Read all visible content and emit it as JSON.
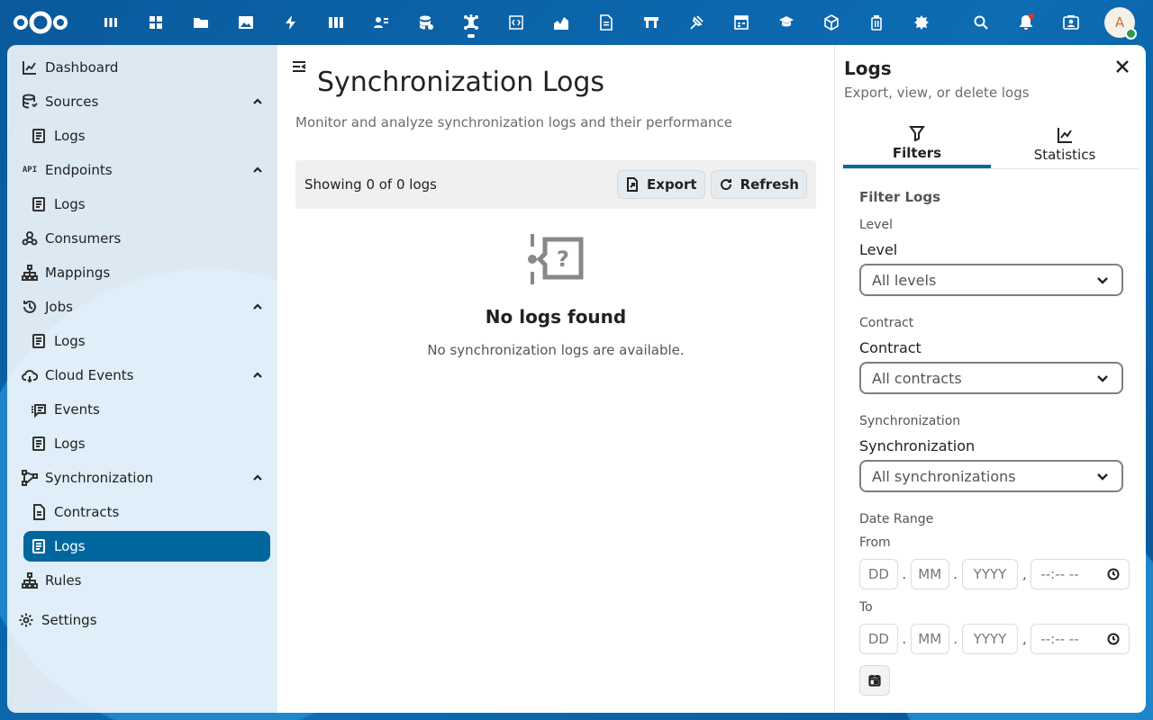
{
  "topbar": {
    "apps": [
      "dashboard-app",
      "tables-app",
      "files-app",
      "photos-app",
      "activity-app",
      "deck-app",
      "contacts-app",
      "database-app",
      "openconnector-app",
      "code-app",
      "analytics-app",
      "documents-app",
      "forms-app",
      "announcements-app",
      "calendar-table-app",
      "education-app",
      "packages-app",
      "archive-app",
      "admin-app"
    ],
    "active_app_index": 8,
    "avatar_letter": "A"
  },
  "sidebar": {
    "items": [
      {
        "label": "Dashboard"
      },
      {
        "label": "Sources"
      },
      {
        "label": "Logs"
      },
      {
        "label": "Endpoints"
      },
      {
        "label": "Logs"
      },
      {
        "label": "Consumers"
      },
      {
        "label": "Mappings"
      },
      {
        "label": "Jobs"
      },
      {
        "label": "Logs"
      },
      {
        "label": "Cloud Events"
      },
      {
        "label": "Events"
      },
      {
        "label": "Logs"
      },
      {
        "label": "Synchronization"
      },
      {
        "label": "Contracts"
      },
      {
        "label": "Logs"
      },
      {
        "label": "Rules"
      },
      {
        "label": "Settings"
      }
    ],
    "api_badge": "API"
  },
  "main": {
    "title": "Synchronization Logs",
    "subtitle": "Monitor and analyze synchronization logs and their performance",
    "count_text": "Showing 0 of 0 logs",
    "export_label": "Export",
    "refresh_label": "Refresh",
    "empty_title": "No logs found",
    "empty_desc": "No synchronization logs are available."
  },
  "panel": {
    "title": "Logs",
    "subtitle": "Export, view, or delete logs",
    "tabs": [
      {
        "label": "Filters"
      },
      {
        "label": "Statistics"
      }
    ],
    "filters_heading": "Filter Logs",
    "level": {
      "caption": "Level",
      "label": "Level",
      "value": "All levels"
    },
    "contract": {
      "caption": "Contract",
      "label": "Contract",
      "value": "All contracts"
    },
    "synchronization": {
      "caption": "Synchronization",
      "label": "Synchronization",
      "value": "All synchronizations"
    },
    "date_range": {
      "caption": "Date Range",
      "from_label": "From",
      "to_label": "To",
      "day_ph": "DD",
      "month_ph": "MM",
      "year_ph": "YYYY",
      "time_ph": "--:-- --",
      "sep_dot": ".",
      "sep_comma": ","
    }
  },
  "colors": {
    "accent": "#00679e",
    "background": "#0b5fa0",
    "notification": "#e9322d",
    "status_online": "#2d9d4a"
  }
}
